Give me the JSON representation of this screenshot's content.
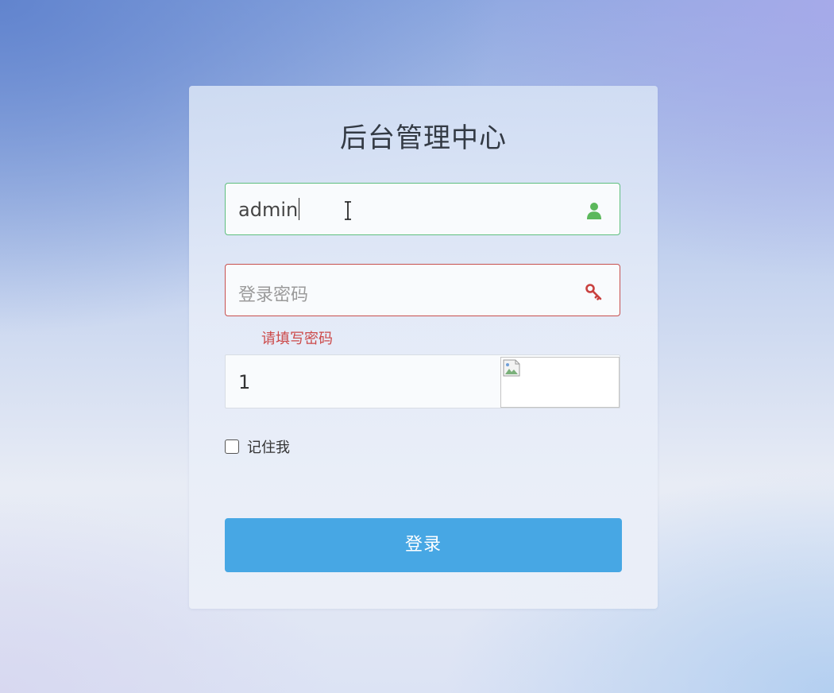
{
  "login_panel": {
    "title": "后台管理中心",
    "username": {
      "value": "admin",
      "icon": "user-icon",
      "border_color": "#5fbf7f"
    },
    "password": {
      "value": "",
      "placeholder": "登录密码",
      "icon": "key-icon",
      "border_color": "#c7504f",
      "error_message": "请填写密码"
    },
    "captcha": {
      "value": "1",
      "image_icon": "broken-image-icon"
    },
    "remember_me": {
      "label": "记住我",
      "checked": false
    },
    "submit_button": {
      "label": "登录",
      "color": "#47a7e4"
    }
  }
}
